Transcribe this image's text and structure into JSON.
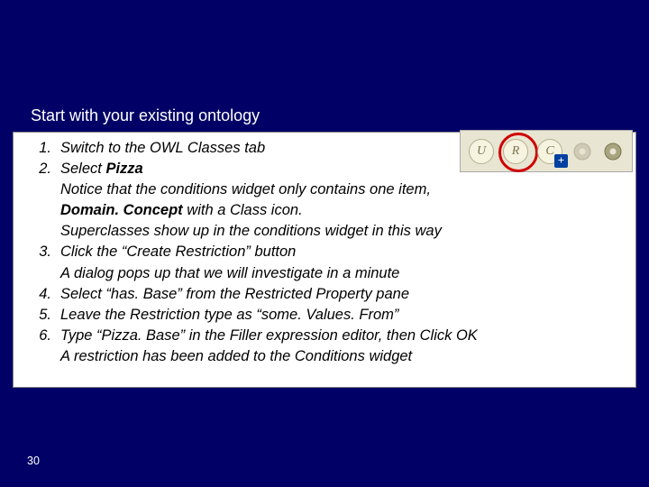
{
  "title": "Start with your existing ontology",
  "steps": [
    {
      "num": "1.",
      "text": "Switch to the OWL Classes tab",
      "notes": []
    },
    {
      "num": "2.",
      "text_parts": [
        "Select ",
        {
          "b": "Pizza"
        }
      ],
      "notes": [
        "Notice that the conditions widget only contains one item,",
        {
          "parts": [
            {
              "b": "Domain. Concept"
            },
            " with a Class icon."
          ]
        },
        "Superclasses show up in the conditions widget in this way"
      ]
    },
    {
      "num": "3.",
      "text": "Click the “Create Restriction” button",
      "notes": [
        "A dialog pops up that we will investigate in a minute"
      ]
    },
    {
      "num": "4.",
      "text": "Select “has. Base” from the Restricted Property pane",
      "notes": []
    },
    {
      "num": "5.",
      "text": "Leave the Restriction type as “some. Values. From”",
      "notes": []
    },
    {
      "num": "6.",
      "text": "Type “Pizza. Base” in the Filler expression editor, then Click OK",
      "notes": [
        "A restriction has been added to the Conditions widget"
      ]
    }
  ],
  "toolbar": {
    "btn_u": "U",
    "btn_r": "R",
    "btn_c": "C",
    "plus": "+"
  },
  "page_number": "30"
}
